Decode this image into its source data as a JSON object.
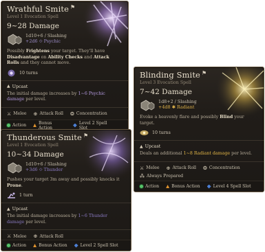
{
  "cards": {
    "wrathful": {
      "title": "Wrathful Smite",
      "subtitle": "Level 1 Evocation Spell",
      "damage": "9~28 Damage",
      "dice_line1": "1d10+6 / Slashing",
      "dice_line2": "+2d6 ⟐ Psychic",
      "desc": [
        {
          "t": "Possibly ",
          "b": false
        },
        {
          "t": "Frightens",
          "b": true
        },
        {
          "t": " your target. They'll have ",
          "b": false
        },
        {
          "t": "Disadvantage",
          "b": true
        },
        {
          "t": " on ",
          "b": false
        },
        {
          "t": "Ability Checks",
          "b": true
        },
        {
          "t": " and ",
          "b": false
        },
        {
          "t": "Attack Rolls",
          "b": true
        },
        {
          "t": " and they cannot move.",
          "b": false
        }
      ],
      "duration": "10 turns",
      "upcast_title": "Upcast",
      "upcast_pre": "The initial damage increases by ",
      "upcast_hl": "1~6 Psychic damage",
      "upcast_post": " per level.",
      "tags": [
        "Melee",
        "Attack Roll",
        "Concentration"
      ],
      "footer": [
        "Action",
        "Bonus Action",
        "Level 2 Spell Slot"
      ]
    },
    "thunderous": {
      "title": "Thunderous Smite",
      "subtitle": "Level 1 Evocation Spell",
      "damage": "10~34 Damage",
      "dice_line1": "1d10+6 / Slashing",
      "dice_line2": "+3d6 ⟐ Thunder",
      "desc_pre": "Pushes your target 3m away and possibly knocks it ",
      "desc_b": "Prone",
      "desc_post": ".",
      "duration": "1 turn",
      "upcast_title": "Upcast",
      "upcast_pre": "The initial damage increases by ",
      "upcast_hl": "1~6 Thunder damage",
      "upcast_post": " per level.",
      "tags": [
        "Melee",
        "Attack Roll"
      ],
      "footer": [
        "Action",
        "Bonus Action",
        "Level 2 Spell Slot"
      ]
    },
    "blinding": {
      "title": "Blinding Smite",
      "subtitle": "Level 3 Evocation Spell",
      "damage": "7~42 Damage",
      "dice_line1": "1d8+2 / Slashing",
      "dice_line2": "+4d8 ✱ Radiant",
      "desc_pre": "Evoke a heavenly flare and possibly ",
      "desc_b": "Blind",
      "desc_post": " your target.",
      "duration": "10 turns",
      "upcast_title": "Upcast",
      "upcast_pre": "Deals an additional ",
      "upcast_hl": "1~8 Radiant damage",
      "upcast_post": " per level.",
      "tags": [
        "Melee",
        "Attack Roll",
        "Concentration",
        "Always Prepared"
      ],
      "footer": [
        "Action",
        "Bonus Action",
        "Level 4 Spell Slot"
      ]
    }
  },
  "colors": {
    "psychic": "#b59ae0",
    "radiant": "#e5b848",
    "thunder": "#8b7bc4",
    "action": "#57c26a",
    "bonus": "#e0932e",
    "slot": "#4c7fd4"
  },
  "icons": {
    "tags": [
      "melee-icon",
      "attack-roll-icon",
      "concentration-icon",
      "always-prepared-icon"
    ],
    "upcast": "upcast-icon",
    "dice": "dice-icon",
    "duration_wrathful": "fear-icon",
    "duration_thunderous": "prone-icon",
    "duration_blinding": "blind-icon"
  }
}
